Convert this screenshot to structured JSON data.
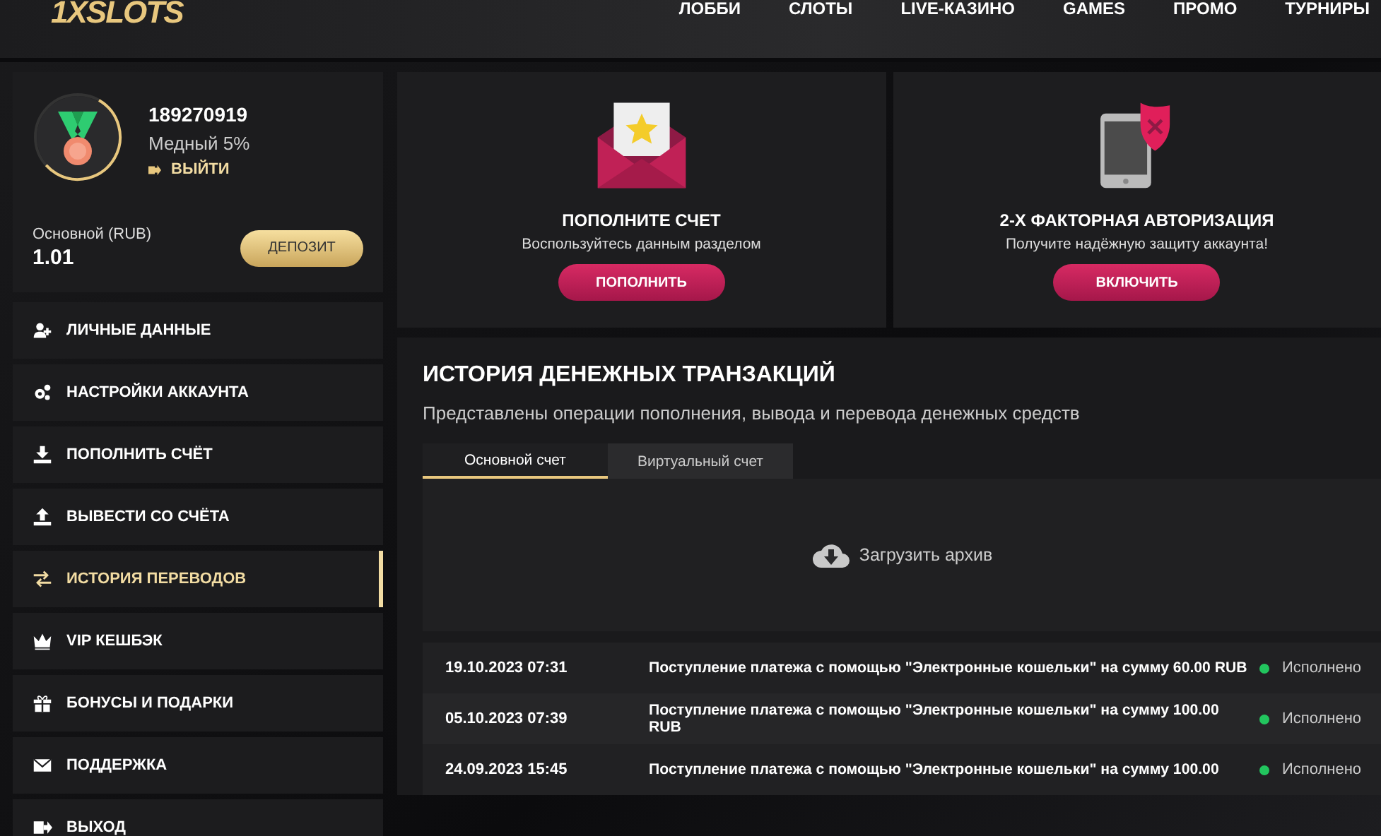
{
  "header": {
    "logo": "1XSLOTS",
    "nav": [
      "ЛОББИ",
      "СЛОТЫ",
      "LIVE-КАЗИНО",
      "GAMES",
      "ПРОМО",
      "ТУРНИРЫ"
    ]
  },
  "profile": {
    "user_id": "189270919",
    "level_name": "Медный 5%",
    "logout": "ВЫЙТИ",
    "level": 0.55,
    "balance_label": "Основной (RUB)",
    "balance": "1.01",
    "deposit_button": "ДЕПОЗИТ"
  },
  "menu": [
    {
      "kind": "person",
      "label": "ЛИЧНЫЕ ДАННЫЕ",
      "selected": false
    },
    {
      "kind": "gears",
      "label": "НАСТРОЙКИ АККАУНТА",
      "selected": false
    },
    {
      "kind": "download",
      "label": "ПОПОЛНИТЬ СЧЁТ",
      "selected": false
    },
    {
      "kind": "upload",
      "label": "ВЫВЕСТИ СО СЧЁТА",
      "selected": false
    },
    {
      "kind": "transfer",
      "label": "ИСТОРИЯ ПЕРЕВОДОВ",
      "selected": true
    },
    {
      "kind": "crown",
      "label": "VIP КЕШБЭК",
      "selected": false
    },
    {
      "kind": "gift",
      "label": "БОНУСЫ И ПОДАРКИ",
      "selected": false
    },
    {
      "kind": "mail",
      "label": "ПОДДЕРЖКА",
      "selected": false
    },
    {
      "kind": "exit",
      "label": "ВЫХОД",
      "selected": false
    }
  ],
  "promo_cards": [
    {
      "kind": "envelope",
      "title": "ПОПОЛНИТЕ СЧЕТ",
      "text": "Воспользуйтесь данным разделом",
      "button": "ПОПОЛНИТЬ"
    },
    {
      "kind": "phone",
      "title": "2-Х ФАКТОРНАЯ АВТОРИЗАЦИЯ",
      "text": "Получите надёжную защиту аккаунта!",
      "button": "ВКЛЮЧИТЬ"
    }
  ],
  "history": {
    "title": "ИСТОРИЯ ДЕНЕЖНЫХ ТРАНЗАКЦИЙ",
    "subtitle": "Представлены операции пополнения, вывода и перевода денежных средств",
    "tabs": [
      {
        "label": "Основной счет",
        "selected": true
      },
      {
        "label": "Виртуальный счет",
        "selected": false
      }
    ],
    "download": "Загрузить архив",
    "rows": [
      {
        "date": "19.10.2023 07:31",
        "description": "Поступление платежа с помощью \"Электронные кошельки\" на сумму 60.00 RUB",
        "status": "Исполнено",
        "color": "#22c55e"
      },
      {
        "date": "05.10.2023 07:39",
        "description": "Поступление платежа с помощью \"Электронные кошельки\" на сумму 100.00 RUB",
        "status": "Исполнено",
        "color": "#22c55e"
      },
      {
        "date": "24.09.2023 15:45",
        "description": "Поступление платежа с помощью \"Электронные кошельки\" на сумму 100.00",
        "status": "Исполнено",
        "color": "#22c55e"
      }
    ]
  }
}
